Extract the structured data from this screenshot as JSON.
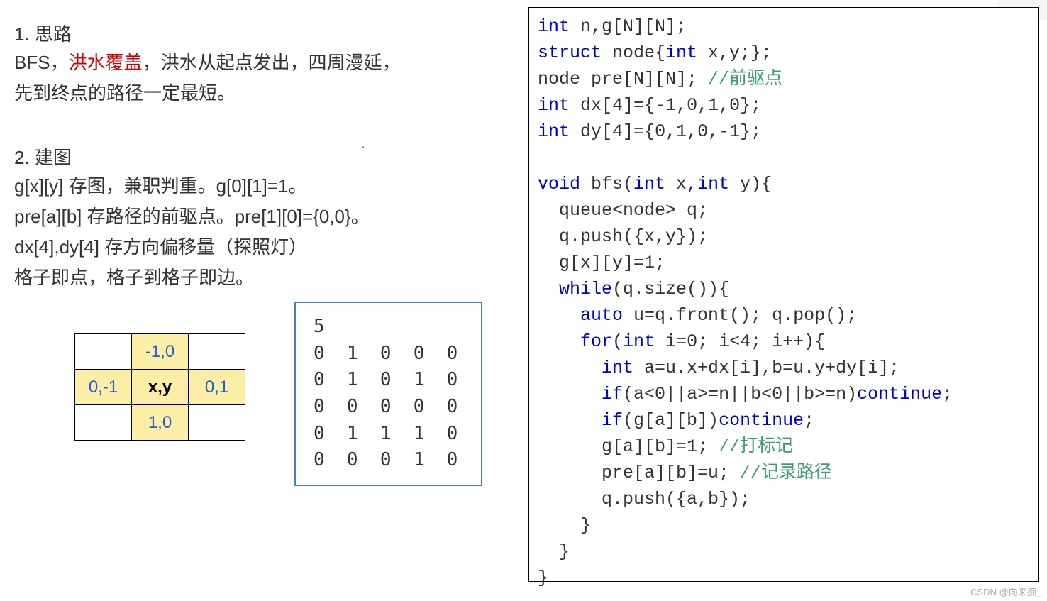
{
  "left": {
    "h1": "1. 思路",
    "p1_a": "BFS，",
    "p1_red": "洪水覆盖",
    "p1_b": "，洪水从起点发出，四周漫延，",
    "p2": "先到终点的路径一定最短。",
    "h2": "2. 建图",
    "g1": "g[x][y] 存图，兼职判重。g[0][1]=1。",
    "g2": "pre[a][b] 存路径的前驱点。pre[1][0]={0,0}。",
    "g3": "dx[4],dy[4] 存方向偏移量（探照灯）",
    "g4": "格子即点，格子到格子即边。"
  },
  "grid": {
    "up": "-1,0",
    "left": "0,-1",
    "center": "x,y",
    "right": "0,1",
    "down": "1,0"
  },
  "maze": "5\n0 1 0 0 0\n0 1 0 1 0\n0 0 0 0 0\n0 1 1 1 0\n0 0 0 1 0",
  "code": {
    "l1a": "int",
    "l1b": " n,g[N][N];",
    "l2a": "struct",
    "l2b": " node{",
    "l2c": "int",
    "l2d": " x,y;};",
    "l3a": "node pre[N][N]; ",
    "l3c": "//前驱点",
    "l4a": "int",
    "l4b": " dx[",
    "l4n": "4",
    "l4c": "]={-",
    "l4d": "1",
    "l4e": ",",
    "l4f": "0",
    "l4g": ",",
    "l4h": "1",
    "l4i": ",",
    "l4j": "0",
    "l4k": "};",
    "l5a": "int",
    "l5b": " dy[",
    "l5n": "4",
    "l5c": "]={",
    "l5d": "0",
    "l5e": ",",
    "l5f": "1",
    "l5g": ",",
    "l5h": "0",
    "l5i": ",-",
    "l5j": "1",
    "l5k": "};",
    "l6": "",
    "l7a": "void",
    "l7b": " bfs(",
    "l7c": "int",
    "l7d": " x,",
    "l7e": "int",
    "l7f": " y){",
    "l8": "  queue<node> q;",
    "l9": "  q.push({x,y});",
    "l10a": "  g[x][y]=",
    "l10n": "1",
    "l10b": ";",
    "l11a": "  ",
    "l11b": "while",
    "l11c": "(q.size()){",
    "l12a": "    ",
    "l12b": "auto",
    "l12c": " u=q.front(); q.pop();",
    "l13a": "    ",
    "l13b": "for",
    "l13c": "(",
    "l13d": "int",
    "l13e": " i=",
    "l13f": "0",
    "l13g": "; i<",
    "l13h": "4",
    "l13i": "; i++){",
    "l14a": "      ",
    "l14b": "int",
    "l14c": " a=u.x+dx[i],b=u.y+dy[i];",
    "l15a": "      ",
    "l15b": "if",
    "l15c": "(a<",
    "l15d": "0",
    "l15e": "||a>=n||b<",
    "l15f": "0",
    "l15g": "||b>=n)",
    "l15h": "continue",
    "l15i": ";",
    "l16a": "      ",
    "l16b": "if",
    "l16c": "(g[a][b])",
    "l16d": "continue",
    "l16e": ";",
    "l17a": "      g[a][b]=",
    "l17n": "1",
    "l17b": "; ",
    "l17c": "//打标记",
    "l18a": "      pre[a][b]=u; ",
    "l18c": "//记录路径",
    "l19": "      q.push({a,b});",
    "l20": "    }",
    "l21": "  }",
    "l22": "}"
  },
  "watermark": "CSDN @向来痴_",
  "chart_data": {
    "type": "table",
    "description": "Direction offset grid for BFS (dx,dy from center cell x,y)",
    "rows": [
      [
        "",
        "-1,0",
        ""
      ],
      [
        "0,-1",
        "x,y",
        "0,1"
      ],
      [
        "",
        "1,0",
        ""
      ]
    ],
    "maze_input": {
      "n": 5,
      "grid": [
        [
          0,
          1,
          0,
          0,
          0
        ],
        [
          0,
          1,
          0,
          1,
          0
        ],
        [
          0,
          0,
          0,
          0,
          0
        ],
        [
          0,
          1,
          1,
          1,
          0
        ],
        [
          0,
          0,
          0,
          1,
          0
        ]
      ]
    }
  }
}
